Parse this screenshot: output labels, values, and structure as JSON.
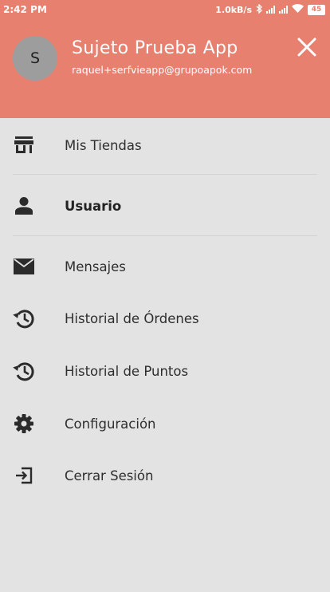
{
  "status_bar": {
    "time": "2:42 PM",
    "net_speed": "1.0kB/s",
    "battery": "45"
  },
  "profile": {
    "avatar_initial": "S",
    "name": "Sujeto Prueba App",
    "email": "raquel+serfvieapp@grupoapok.com"
  },
  "menu": {
    "items": [
      {
        "label": "Mis Tiendas",
        "icon": "store-icon"
      },
      {
        "label": "Usuario",
        "icon": "person-icon"
      },
      {
        "label": "Mensajes",
        "icon": "envelope-icon"
      },
      {
        "label": "Historial de Órdenes",
        "icon": "history-icon"
      },
      {
        "label": "Historial de Puntos",
        "icon": "history-icon"
      },
      {
        "label": "Configuración",
        "icon": "gear-icon"
      },
      {
        "label": "Cerrar Sesión",
        "icon": "logout-icon"
      }
    ]
  },
  "colors": {
    "header": "#e8806f",
    "drawer_background": "#e3e3e3",
    "icon": "#2b2b2b"
  }
}
